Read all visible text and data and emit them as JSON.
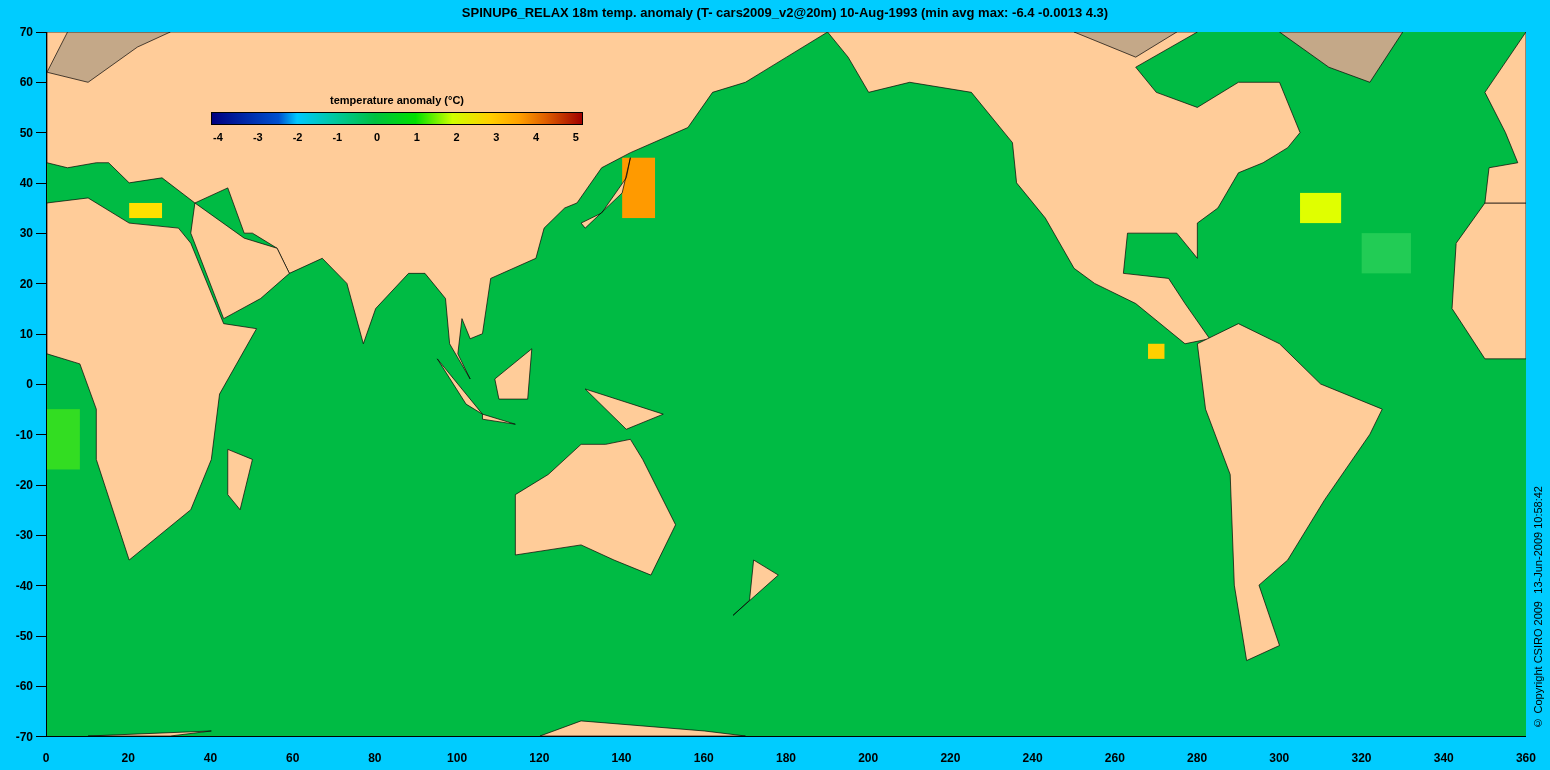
{
  "title": "SPINUP6_RELAX 18m temp. anomaly (T- cars2009_v2@20m) 10-Aug-1993 (min avg max: -6.4 -0.0013 4.3)",
  "colorbar": {
    "title": "temperature anomaly (°C)",
    "ticks": [
      "-4",
      "-3",
      "-2",
      "-1",
      "0",
      "1",
      "2",
      "3",
      "4",
      "5"
    ]
  },
  "y_ticks": [
    "70",
    "60",
    "50",
    "40",
    "30",
    "20",
    "10",
    "0",
    "-10",
    "-20",
    "-30",
    "-40",
    "-50",
    "-60",
    "-70"
  ],
  "x_ticks": [
    "0",
    "20",
    "40",
    "60",
    "80",
    "100",
    "120",
    "140",
    "160",
    "180",
    "200",
    "220",
    "240",
    "260",
    "280",
    "300",
    "320",
    "340",
    "360"
  ],
  "credits": [
    "© Copyright CSIRO 2009",
    "13-Jun-2009 10:58:42"
  ]
}
